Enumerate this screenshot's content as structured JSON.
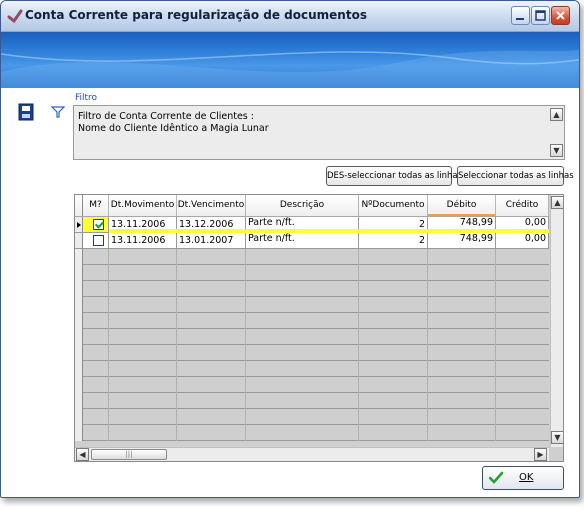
{
  "window": {
    "title": "Conta Corrente para regularização de documentos",
    "controls": {
      "minimize": "minimize-icon",
      "maximize": "maximize-icon",
      "close": "close-icon"
    }
  },
  "filter": {
    "label": "Filtro",
    "lines": [
      "Filtro de Conta Corrente de Clientes :",
      "Nome do Cliente Idêntico a Magia Lunar"
    ]
  },
  "actions": {
    "deselect_all": "DES-seleccionar todas as linhas",
    "select_all": "Seleccionar todas as linhas"
  },
  "grid": {
    "columns": [
      "M?",
      "Dt.Movimento",
      "Dt.Vencimento",
      "Descrição",
      "NºDocumento",
      "Débito",
      "Crédito"
    ],
    "rows": [
      {
        "selected": true,
        "dt_movimento": "13.11.2006",
        "dt_vencimento": "13.12.2006",
        "descricao": "Parte n/ft.",
        "documento": "2",
        "debito": "748,99",
        "credito": "0,00"
      },
      {
        "selected": false,
        "dt_movimento": "13.11.2006",
        "dt_vencimento": "13.01.2007",
        "descricao": "Parte n/ft.",
        "documento": "2",
        "debito": "748,99",
        "credito": "0,00"
      }
    ]
  },
  "buttons": {
    "ok": "OK"
  },
  "colors": {
    "highlight_row": "#ffff33",
    "banner": "#2f7fd8",
    "link_blue": "#1f4fb8"
  }
}
